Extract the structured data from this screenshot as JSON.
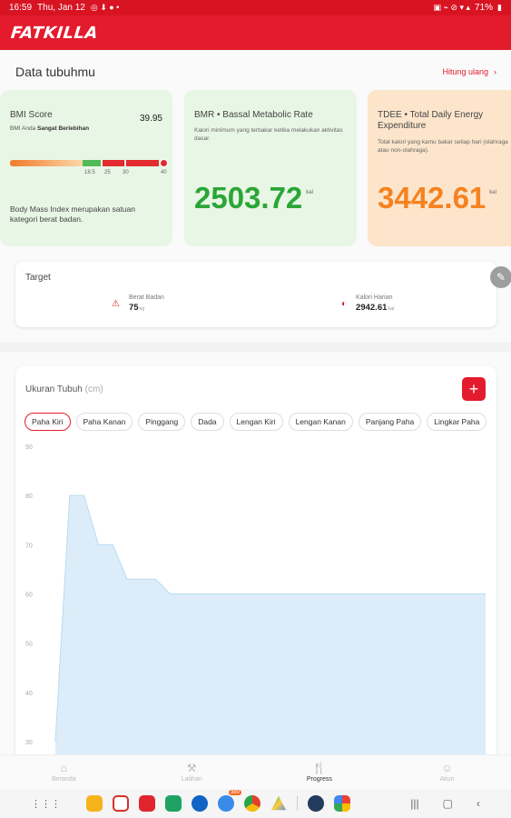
{
  "status_bar": {
    "time": "16:59",
    "date": "Thu, Jan 12",
    "battery": "71%"
  },
  "app": {
    "logo": "FATKILLA"
  },
  "body_data": {
    "title": "Data tubuhmu",
    "recalc_label": "Hitung ulang"
  },
  "bmi": {
    "label": "BMI Score",
    "score": "39.95",
    "status_prefix": "BMI Anda",
    "status": "Sangat Berlebihan",
    "ticks": [
      "18.5",
      "25",
      "30",
      "40"
    ],
    "description": "Body Mass Index merupakan satuan kategori berat badan."
  },
  "bmr": {
    "label": "BMR • Bassal Metabolic Rate",
    "description": "Kalori minimum yang terbakar ketika melakukan aktivitas dasar.",
    "value": "2503.72",
    "unit": "kal"
  },
  "tdee": {
    "label": "TDEE • Total Daily Energy Expenditure",
    "description": "Total kalori yang kamu bakar setiap hari (olahraga atau non-olahraga).",
    "value": "3442.61",
    "unit": "kal"
  },
  "target": {
    "title": "Target",
    "weight_label": "Berat Badan",
    "weight_value": "75",
    "weight_unit": "kg",
    "calorie_label": "Kalori Harian",
    "calorie_value": "2942.61",
    "calorie_unit": "kal"
  },
  "measurements": {
    "title": "Ukuran Tubuh",
    "unit": "(cm)",
    "chips": [
      "Paha Kiri",
      "Paha Kanan",
      "Pinggang",
      "Dada",
      "Lengan Kiri",
      "Lengan Kanan",
      "Panjang Paha",
      "Lingkar Paha"
    ]
  },
  "chart_data": {
    "type": "area",
    "y_ticks": [
      90,
      80,
      70,
      60,
      50,
      40,
      30
    ],
    "ylim": [
      30,
      90
    ],
    "values": [
      30,
      80,
      80,
      70,
      70,
      63,
      63,
      63,
      60,
      60,
      60,
      60,
      60,
      60,
      60,
      60,
      60,
      60,
      60,
      60,
      60,
      60,
      60,
      60,
      60,
      60,
      60,
      60,
      60,
      60,
      60
    ],
    "fill_color": "#dcedf9",
    "line_color": "#b7dbf3"
  },
  "nav": {
    "items": [
      {
        "label": "Beranda",
        "icon": "home-icon"
      },
      {
        "label": "Latihan",
        "icon": "dumbbell-icon"
      },
      {
        "label": "Progress",
        "icon": "cutlery-icon"
      },
      {
        "label": "Akun",
        "icon": "user-icon"
      }
    ]
  },
  "dock": {
    "message_badge": "380"
  },
  "colors": {
    "brand_red": "#e31b2c",
    "green": "#2aa637",
    "orange": "#f58220"
  }
}
